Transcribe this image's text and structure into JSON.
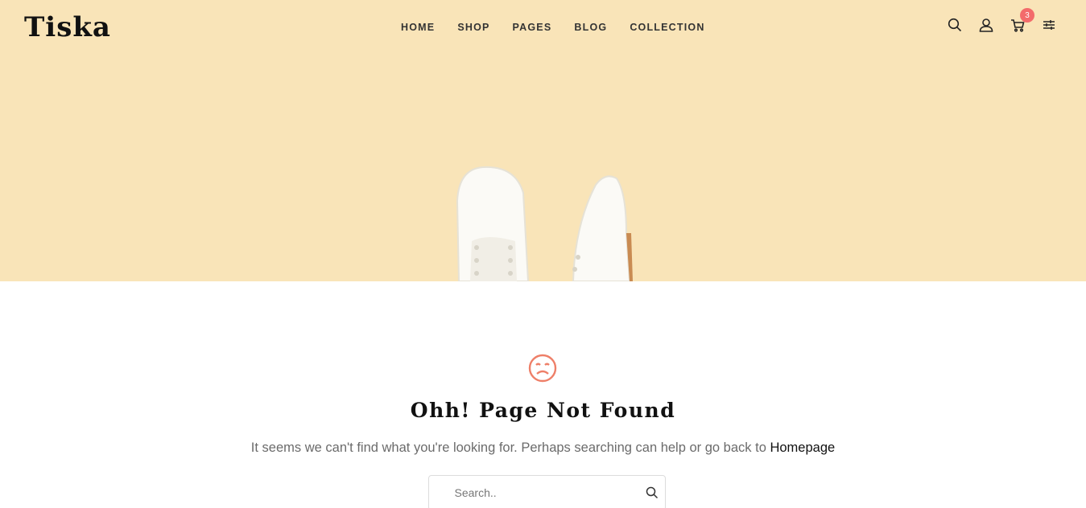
{
  "brand": {
    "logo_text": "Tiska"
  },
  "nav": {
    "items": [
      {
        "label": "HOME"
      },
      {
        "label": "SHOP"
      },
      {
        "label": "PAGES"
      },
      {
        "label": "BLOG"
      },
      {
        "label": "COLLECTION"
      }
    ]
  },
  "toolbar": {
    "icons": [
      "search-icon",
      "user-icon",
      "cart-icon",
      "sliders-icon"
    ],
    "cart_count": "3"
  },
  "hero": {
    "background": "#f9e4b8"
  },
  "error": {
    "icon": "sad-face-icon",
    "icon_color": "#ee7f68",
    "title": "Ohh! Page Not Found",
    "message": "It seems we can't find what you're looking for. Perhaps searching can help or go back to",
    "home_link": "Homepage"
  },
  "search": {
    "placeholder": "Search.."
  },
  "colors": {
    "badge": "#f36b6b",
    "accent": "#ee7f68"
  }
}
